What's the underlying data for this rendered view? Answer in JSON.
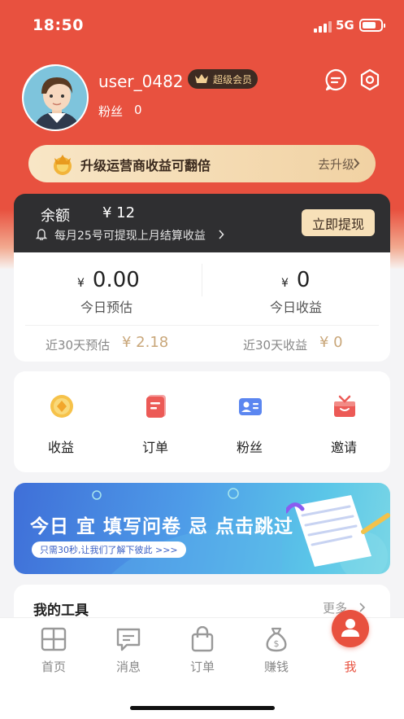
{
  "status": {
    "time": "18:50",
    "network": "5G"
  },
  "profile": {
    "username": "user_0482",
    "vip_label": "超级会员",
    "fans_label": "粉丝",
    "fans_count": "0"
  },
  "upgrade": {
    "text": "升级运营商收益可翻倍",
    "action": "去升级"
  },
  "balance": {
    "label": "余额",
    "value": "¥  12",
    "note": "每月25号可提现上月结算收益",
    "withdraw_label": "立即提现"
  },
  "stats": {
    "currency": "¥",
    "today_estimate_value": "0.00",
    "today_estimate_label": "今日预估",
    "today_income_value": "0",
    "today_income_label": "今日收益",
    "month_estimate_label": "近30天预估",
    "month_estimate_value": "¥  2.18",
    "month_income_label": "近30天收益",
    "month_income_value": "¥  0"
  },
  "menu": [
    {
      "label": "收益",
      "icon": "coin-icon"
    },
    {
      "label": "订单",
      "icon": "order-icon"
    },
    {
      "label": "粉丝",
      "icon": "fans-card-icon"
    },
    {
      "label": "邀请",
      "icon": "gift-icon"
    }
  ],
  "ad": {
    "title": "今日 宜 填写问卷 忌 点击跳过",
    "subtitle": "只需30秒,让我们了解下彼此 >>>"
  },
  "tools": {
    "title": "我的工具",
    "more": "更多"
  },
  "tabs": [
    {
      "label": "首页",
      "icon": "home-grid-icon"
    },
    {
      "label": "消息",
      "icon": "message-icon"
    },
    {
      "label": "订单",
      "icon": "shopping-bag-icon"
    },
    {
      "label": "赚钱",
      "icon": "money-bag-icon"
    },
    {
      "label": "我",
      "icon": "user-icon"
    }
  ],
  "colors": {
    "brand": "#e8513f",
    "dark_card": "#2f2f31",
    "gold": "#c9a77a"
  }
}
